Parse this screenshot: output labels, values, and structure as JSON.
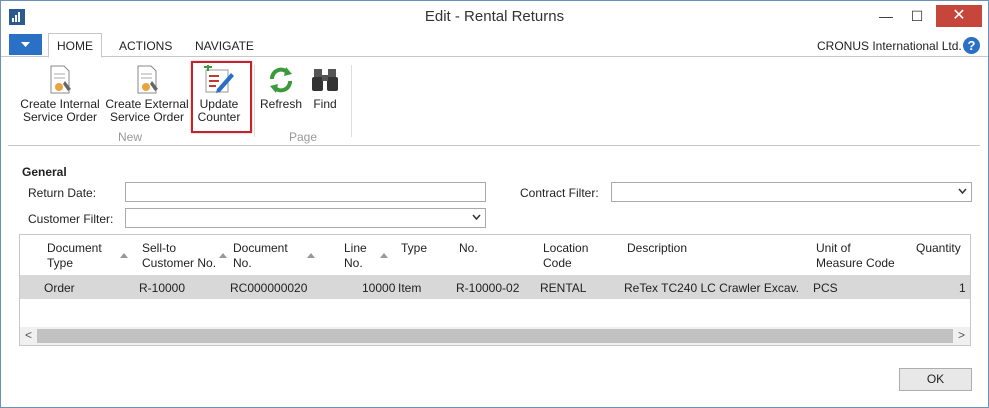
{
  "window": {
    "title": "Edit - Rental Returns",
    "minimize_glyph": "—",
    "maximize_glyph": "☐",
    "close_glyph": "✕"
  },
  "menu": {
    "tabs": [
      "HOME",
      "ACTIONS",
      "NAVIGATE"
    ],
    "company": "CRONUS International Ltd.",
    "help_glyph": "?"
  },
  "ribbon": {
    "groups": [
      {
        "label": "New",
        "buttons": [
          {
            "label_line1": "Create Internal",
            "label_line2": "Service Order",
            "icon": "document-wrench-icon"
          },
          {
            "label_line1": "Create External",
            "label_line2": "Service Order",
            "icon": "document-wrench-icon"
          },
          {
            "label_line1": "Update",
            "label_line2": "Counter",
            "icon": "edit-list-icon"
          }
        ]
      },
      {
        "label": "Page",
        "buttons": [
          {
            "label": "Refresh",
            "icon": "refresh-icon"
          },
          {
            "label": "Find",
            "icon": "binoculars-icon"
          }
        ]
      }
    ]
  },
  "general": {
    "title": "General",
    "return_date_label": "Return Date:",
    "return_date_value": "",
    "customer_filter_label": "Customer Filter:",
    "customer_filter_value": "",
    "contract_filter_label": "Contract Filter:",
    "contract_filter_value": ""
  },
  "table": {
    "columns": [
      {
        "line1": "Document",
        "line2": "Type"
      },
      {
        "line1": "Sell-to",
        "line2": "Customer No."
      },
      {
        "line1": "Document",
        "line2": "No."
      },
      {
        "line1": "Line",
        "line2": "No."
      },
      {
        "line1": "Type",
        "line2": ""
      },
      {
        "line1": "No.",
        "line2": ""
      },
      {
        "line1": "Location",
        "line2": "Code"
      },
      {
        "line1": "Description",
        "line2": ""
      },
      {
        "line1": "Unit of",
        "line2": "Measure Code"
      },
      {
        "line1": "Quantity",
        "line2": ""
      }
    ],
    "rows": [
      {
        "document_type": "Order",
        "sell_to_customer_no": "R-10000",
        "document_no": "RC000000020",
        "line_no": "10000",
        "type": "Item",
        "no": "R-10000-02",
        "location_code": "RENTAL",
        "description": "ReTex TC240 LC Crawler Excav.",
        "unit_of_measure_code": "PCS",
        "quantity": "1"
      }
    ]
  },
  "footer": {
    "ok_label": "OK"
  },
  "colors": {
    "accent": "#2a71c5",
    "highlight_border": "#c8202c",
    "selected_row": "#d8d8d8",
    "close_button": "#c7463c"
  }
}
